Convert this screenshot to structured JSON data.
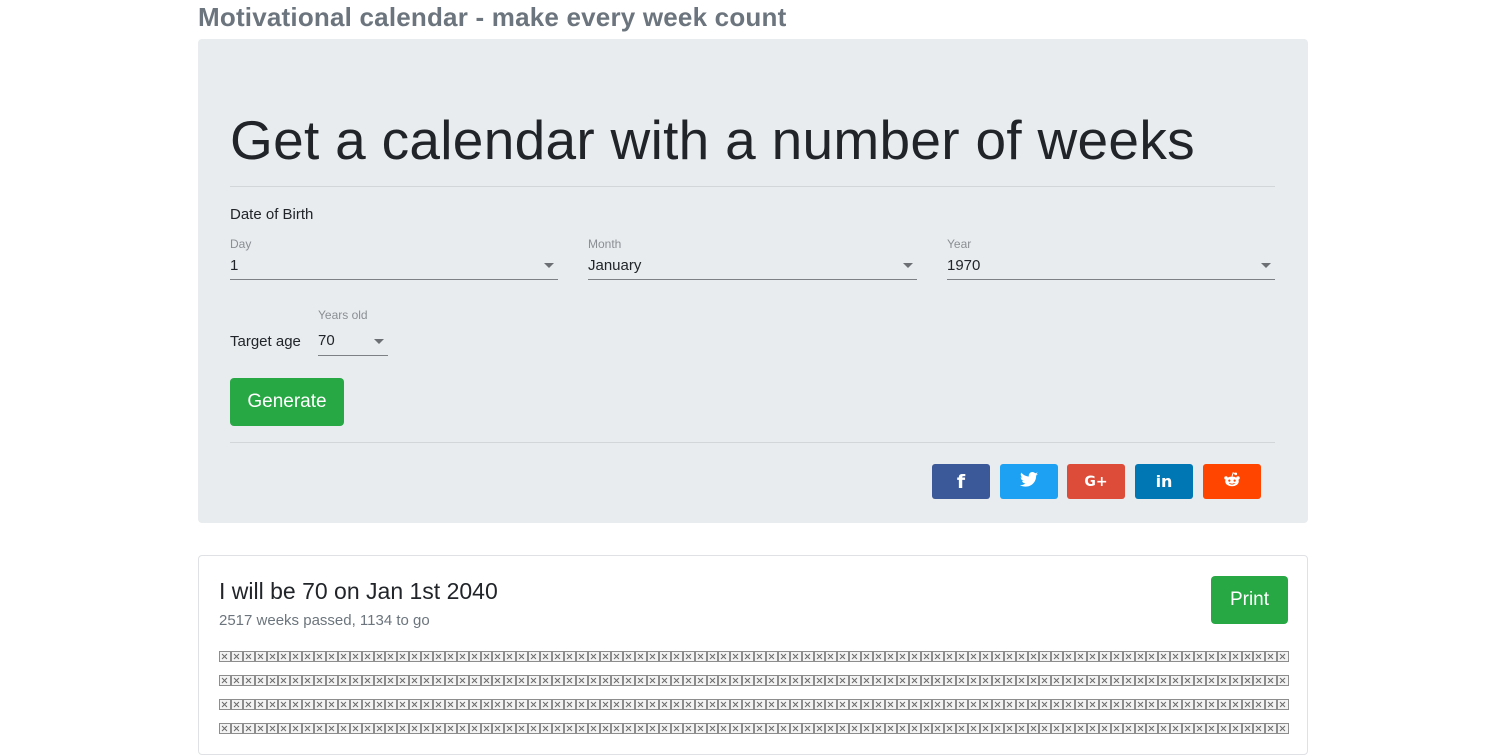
{
  "page": {
    "heading": "Motivational calendar - make every week count"
  },
  "form": {
    "title": "Get a calendar with a number of weeks",
    "dob_label": "Date of Birth",
    "day": {
      "label": "Day",
      "value": "1"
    },
    "month": {
      "label": "Month",
      "value": "January"
    },
    "year": {
      "label": "Year",
      "value": "1970"
    },
    "target": {
      "label": "Target age",
      "small_label": "Years old",
      "value": "70"
    },
    "generate_label": "Generate"
  },
  "share": {
    "buttons": [
      {
        "name": "facebook",
        "glyph": "f",
        "color": "#3b5998"
      },
      {
        "name": "twitter",
        "glyph": "🐦",
        "color": "#1da1f2"
      },
      {
        "name": "google-plus",
        "glyph": "G+",
        "color": "#dd4b39"
      },
      {
        "name": "linkedin",
        "glyph": "in",
        "color": "#0077b5"
      },
      {
        "name": "reddit",
        "glyph": "👽",
        "color": "#ff4500"
      }
    ]
  },
  "result": {
    "title": "I will be 70 on Jan 1st 2040",
    "subtitle": "2517 weeks passed, 1134 to go",
    "print_label": "Print",
    "weeks_per_row": 90,
    "visible_rows": 4,
    "weeks_passed": 2517
  }
}
